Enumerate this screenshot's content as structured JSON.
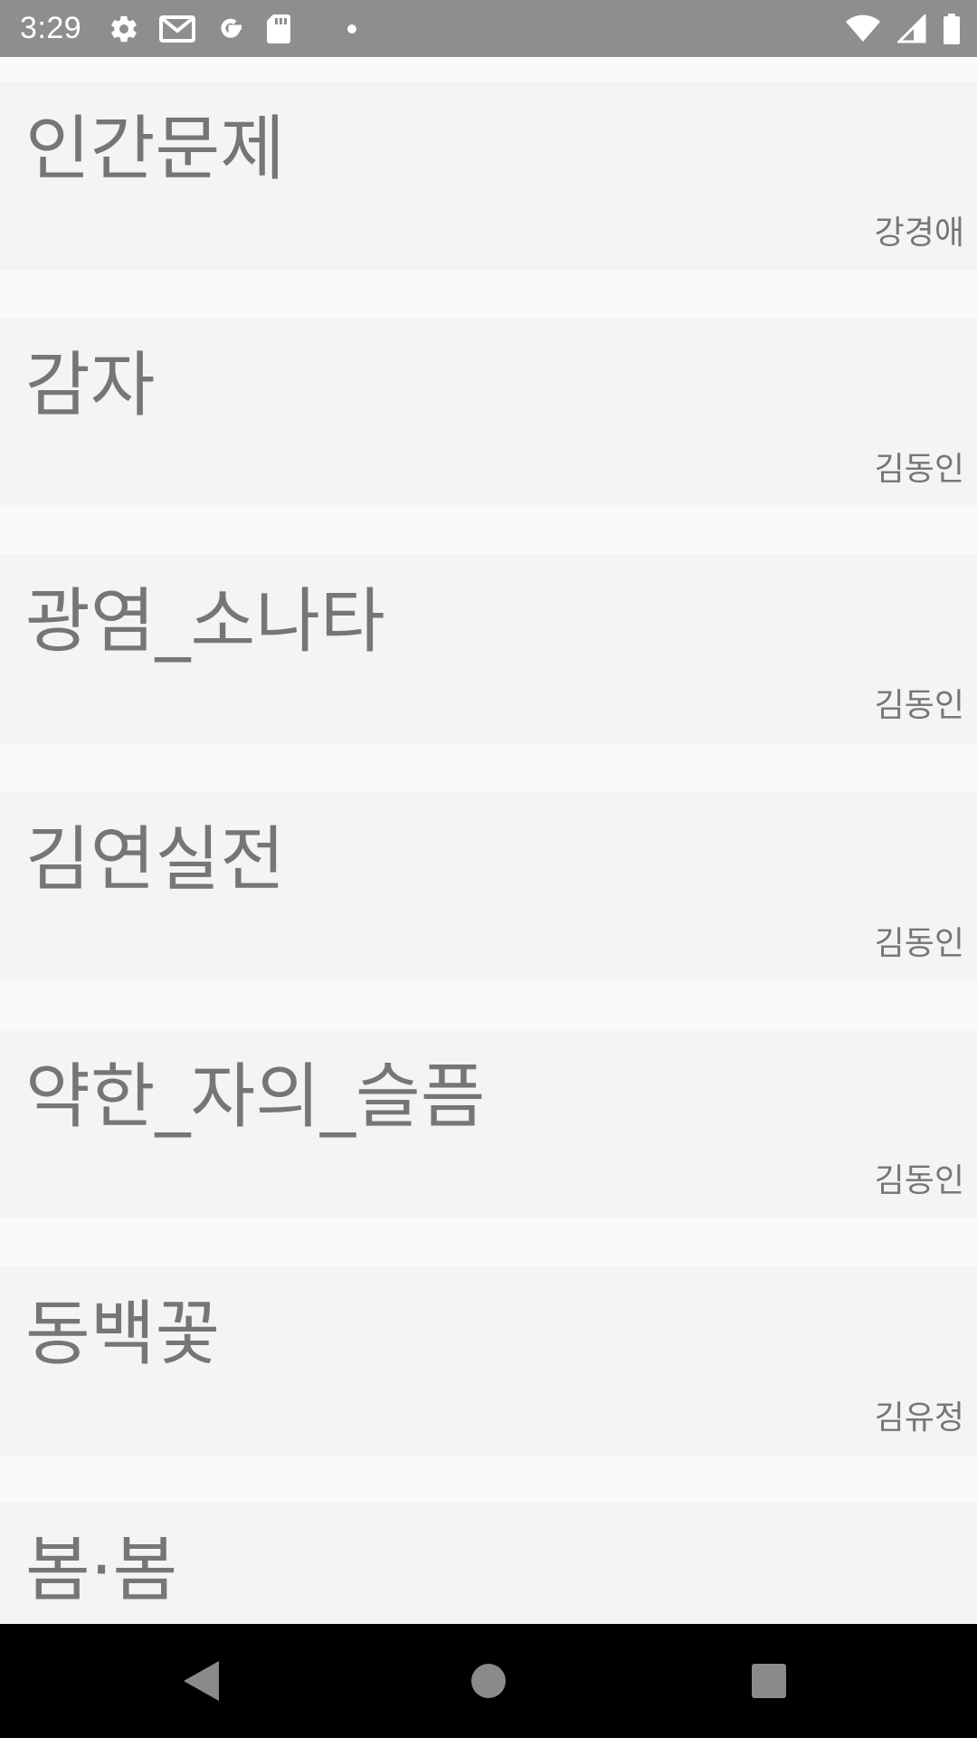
{
  "status_bar": {
    "time": "3:29",
    "icons_left": [
      "settings-icon",
      "gmail-icon",
      "google-icon",
      "sd-card-icon",
      "dot-icon"
    ],
    "icons_right": [
      "wifi-icon",
      "cell-signal-icon",
      "battery-icon"
    ]
  },
  "list": {
    "items": [
      {
        "title": "인간문제",
        "author": "강경애"
      },
      {
        "title": "감자",
        "author": "김동인"
      },
      {
        "title": "광염_소나타",
        "author": "김동인"
      },
      {
        "title": "김연실전",
        "author": "김동인"
      },
      {
        "title": "약한_자의_슬픔",
        "author": "김동인"
      },
      {
        "title": "동백꽃",
        "author": "김유정"
      },
      {
        "title": "봄·봄",
        "author": ""
      }
    ]
  },
  "nav_bar": {
    "buttons": [
      "back-icon",
      "home-icon",
      "recents-icon"
    ]
  },
  "colors": {
    "status_bar_bg": "#8e8e8e",
    "card_bg": "#f4f4f4",
    "page_bg": "#fafafa",
    "text": "#767676",
    "nav_bar_bg": "#000000"
  }
}
